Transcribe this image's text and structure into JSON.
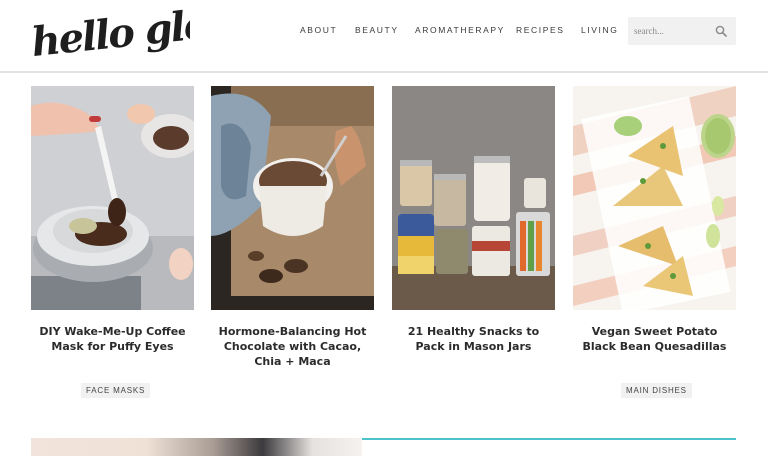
{
  "site": {
    "logo_text": "hello glow"
  },
  "nav": {
    "items": [
      "ABOUT",
      "BEAUTY",
      "AROMATHERAPY",
      "RECIPES",
      "LIVING"
    ]
  },
  "search": {
    "placeholder": "search..."
  },
  "cards": [
    {
      "title": "DIY Wake-Me-Up Coffee Mask for Puffy Eyes",
      "tag": "FACE MASKS"
    },
    {
      "title": "Hormone-Balancing Hot Chocolate with Cacao, Chia + Maca",
      "tag": ""
    },
    {
      "title": "21 Healthy Snacks to Pack in Mason Jars",
      "tag": ""
    },
    {
      "title": "Vegan Sweet Potato Black Bean Quesadillas",
      "tag": "MAIN DISHES"
    }
  ],
  "colors": {
    "accent": "#4cc3cc",
    "tag_bg": "#f1f1f1"
  }
}
